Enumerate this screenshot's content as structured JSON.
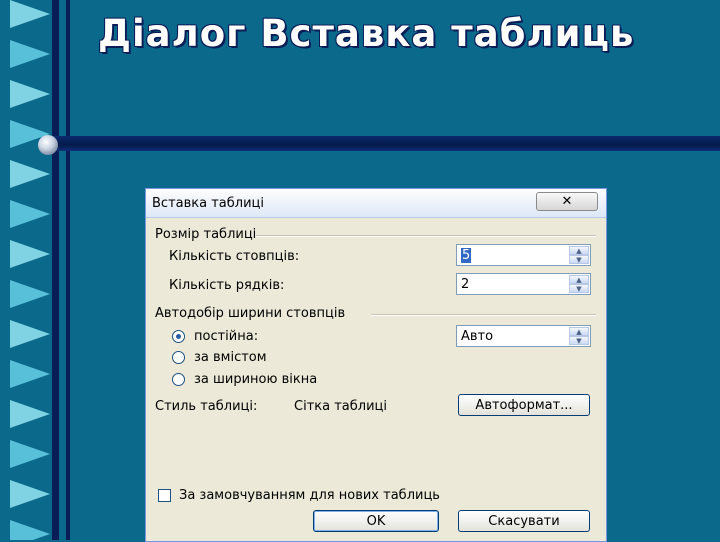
{
  "slide": {
    "title": "Діалог Вставка таблиць"
  },
  "dialog": {
    "title": "Вставка таблиці",
    "close_icon": "close-x-icon",
    "close_glyph": "✕",
    "size_group": {
      "label": "Розмір таблиці",
      "columns_label": "Кількість стовпців:",
      "columns_value": "5",
      "rows_label": "Кількість рядків:",
      "rows_value": "2"
    },
    "autofit_group": {
      "label": "Автодобір ширини стовпців",
      "options": [
        {
          "label": "постійна:",
          "selected": true
        },
        {
          "label": "за вмістом",
          "selected": false
        },
        {
          "label": "за шириною вікна",
          "selected": false
        }
      ],
      "fixed_value": "Авто"
    },
    "style": {
      "label": "Стиль таблиці:",
      "value": "Сітка таблиці",
      "autoformat_button": "Автоформат..."
    },
    "default_checkbox": {
      "label": "За замовчуванням для нових таблиць",
      "checked": false
    },
    "ok_button": "OK",
    "cancel_button": "Скасувати",
    "spinner_up": "▲",
    "spinner_down": "▼"
  }
}
